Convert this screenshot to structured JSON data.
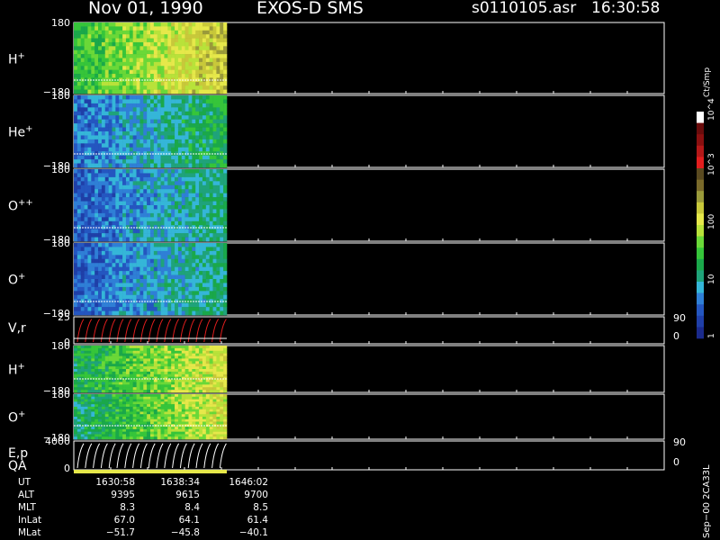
{
  "header": {
    "date": "Nov 01, 1990",
    "mission": "EXOS-D SMS",
    "file": "s0110105.asr",
    "time": "16:30:58"
  },
  "colors": {
    "axis": "#ffffff",
    "fill_background": "#000000",
    "scale": [
      "#1a2a8c",
      "#1f3fa8",
      "#2456c0",
      "#2f7fd6",
      "#35b6d8",
      "#1fa37a",
      "#1aa84a",
      "#36c53a",
      "#6ad838",
      "#b8e23a",
      "#e6e84a",
      "#c8c83a",
      "#9a9a3a",
      "#7a6a2a",
      "#5a4a20",
      "#e21e1e",
      "#b41818",
      "#8a1010",
      "#6a0c0c",
      "#ffffff"
    ]
  },
  "chart_data": {
    "type": "heatmap",
    "title": "Nov 01, 1990   EXOS-D SMS",
    "x_time_labels": [
      "1630:58",
      "1638:34",
      "1646:02"
    ],
    "colorbar": {
      "unit": "Ct/Smp",
      "scale": "log",
      "tick_labels": [
        "1",
        "10",
        "100",
        "10^3",
        "10^4"
      ],
      "range": [
        1,
        10000
      ]
    },
    "panels": [
      {
        "name": "H+",
        "label_base": "H",
        "label_sup": "+",
        "ytick_top": "180",
        "ytick_bottom": "−180",
        "right_top": "",
        "right_bottom": "",
        "kind": "heat"
      },
      {
        "name": "He+",
        "label_base": "He",
        "label_sup": "+",
        "ytick_top": "180",
        "ytick_bottom": "−180",
        "right_top": "",
        "right_bottom": "",
        "kind": "heat"
      },
      {
        "name": "O++",
        "label_base": "O",
        "label_sup": "++",
        "ytick_top": "180",
        "ytick_bottom": "−180",
        "right_top": "",
        "right_bottom": "",
        "kind": "heat"
      },
      {
        "name": "O+",
        "label_base": "O",
        "label_sup": "+",
        "ytick_top": "180",
        "ytick_bottom": "−180",
        "right_top": "",
        "right_bottom": "",
        "kind": "heat"
      },
      {
        "name": "V,r",
        "label_base": "V,r",
        "label_sup": "",
        "ytick_top": "25",
        "ytick_bottom": "0",
        "right_top": "90",
        "right_bottom": "0",
        "kind": "line"
      },
      {
        "name": "H+",
        "label_base": "H",
        "label_sup": "+",
        "ytick_top": "180",
        "ytick_bottom": "−180",
        "right_top": "",
        "right_bottom": "",
        "kind": "heat"
      },
      {
        "name": "O+",
        "label_base": "O",
        "label_sup": "+",
        "ytick_top": "180",
        "ytick_bottom": "−180",
        "right_top": "",
        "right_bottom": "",
        "kind": "heat"
      },
      {
        "name": "E,p",
        "label_base": "E,p",
        "label_sup": "",
        "ytick_top": "4000",
        "ytick_bottom": "0",
        "right_top": "90",
        "right_bottom": "0",
        "kind": "line"
      }
    ],
    "qa_label": "QA"
  },
  "orbit_table": {
    "rows": [
      {
        "name": "UT",
        "values": [
          "1630:58",
          "1638:34",
          "1646:02"
        ]
      },
      {
        "name": "ALT",
        "values": [
          "9395",
          "9615",
          "9700"
        ]
      },
      {
        "name": "MLT",
        "values": [
          "8.3",
          "8.4",
          "8.5"
        ]
      },
      {
        "name": "InLat",
        "values": [
          "67.0",
          "64.1",
          "61.4"
        ]
      },
      {
        "name": "MLat",
        "values": [
          "−51.7",
          "−45.8",
          "−40.1"
        ]
      }
    ]
  },
  "footer_right": "Sep−00  2CA33L"
}
